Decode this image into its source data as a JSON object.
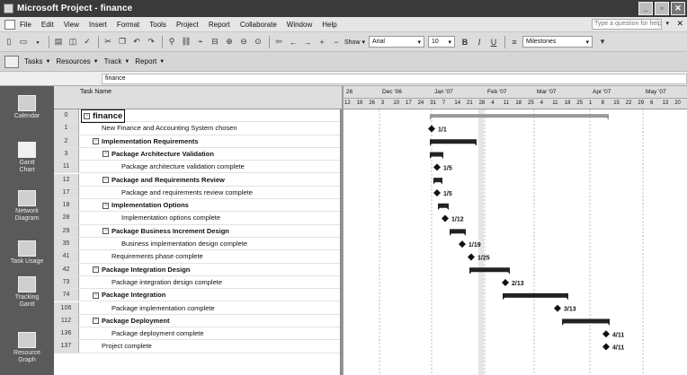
{
  "window": {
    "title": "Microsoft Project - finance",
    "controls": [
      "minimize",
      "restore",
      "close"
    ]
  },
  "menu": {
    "items": [
      "File",
      "Edit",
      "View",
      "Insert",
      "Format",
      "Tools",
      "Project",
      "Report",
      "Collaborate",
      "Window",
      "Help"
    ],
    "help_placeholder": "Type a question for help"
  },
  "toolbar": {
    "show_label": "Show ▾",
    "font": "Arial",
    "font_size": "10",
    "filter": "Milestones",
    "bold": "B",
    "italic": "I",
    "underline": "U"
  },
  "viewbar": {
    "items": [
      "Tasks",
      "Resources",
      "Track",
      "Report"
    ]
  },
  "entry_bar": {
    "value": "finance"
  },
  "view_bar_left": [
    {
      "label": "Calendar",
      "icon": "calendar-icon"
    },
    {
      "label": "Gantt Chart",
      "icon": "gantt-chart-icon"
    },
    {
      "label": "Network Diagram",
      "icon": "network-diagram-icon"
    },
    {
      "label": "Task Usage",
      "icon": "task-usage-icon"
    },
    {
      "label": "Tracking Gantt",
      "icon": "tracking-gantt-icon"
    },
    {
      "label": "Resource Graph",
      "icon": "resource-graph-icon"
    }
  ],
  "table": {
    "header": "Task Name",
    "rows": [
      {
        "id": "0",
        "name": "finance",
        "level": 0,
        "summary": true
      },
      {
        "id": "1",
        "name": "New Finance and Accounting System chosen",
        "level": 1,
        "summary": false
      },
      {
        "id": "2",
        "name": "Implementation Requirements",
        "level": 1,
        "summary": true
      },
      {
        "id": "3",
        "name": "Package Architecture Validation",
        "level": 2,
        "summary": true
      },
      {
        "id": "11",
        "name": "Package architecture validation complete",
        "level": 3,
        "summary": false
      },
      {
        "id": "12",
        "name": "Package and Requirements Review",
        "level": 2,
        "summary": true
      },
      {
        "id": "17",
        "name": "Package and requirements review complete",
        "level": 3,
        "summary": false
      },
      {
        "id": "18",
        "name": "Implementation Options",
        "level": 2,
        "summary": true
      },
      {
        "id": "28",
        "name": "Implementation options complete",
        "level": 3,
        "summary": false
      },
      {
        "id": "29",
        "name": "Package Business Increment Design",
        "level": 2,
        "summary": true
      },
      {
        "id": "35",
        "name": "Business implementation design complete",
        "level": 3,
        "summary": false
      },
      {
        "id": "41",
        "name": "Requirements phase complete",
        "level": 2,
        "summary": false
      },
      {
        "id": "42",
        "name": "Package Integration Design",
        "level": 1,
        "summary": true
      },
      {
        "id": "73",
        "name": "Package integration design complete",
        "level": 2,
        "summary": false
      },
      {
        "id": "74",
        "name": "Package Integration",
        "level": 1,
        "summary": true
      },
      {
        "id": "106",
        "name": "Package implementation complete",
        "level": 2,
        "summary": false
      },
      {
        "id": "112",
        "name": "Package Deployment",
        "level": 1,
        "summary": true
      },
      {
        "id": "136",
        "name": "Package deployment complete",
        "level": 2,
        "summary": false
      },
      {
        "id": "137",
        "name": "Project complete",
        "level": 1,
        "summary": false
      }
    ]
  },
  "timescale": {
    "months": [
      "26",
      "Dec '06",
      "Jan '07",
      "Feb '07",
      "Mar '07",
      "Apr '07",
      "May '07"
    ],
    "days": [
      "12",
      "19",
      "26",
      "3",
      "10",
      "17",
      "24",
      "31",
      "7",
      "14",
      "21",
      "28",
      "4",
      "11",
      "18",
      "25",
      "4",
      "11",
      "18",
      "25",
      "1",
      "8",
      "15",
      "22",
      "29",
      "6",
      "13",
      "20"
    ]
  },
  "gantt": {
    "milestone_labels": {
      "1": "1/1",
      "11": "1/5",
      "17": "1/5",
      "28": "1/12",
      "35": "1/19",
      "41": "1/25",
      "73": "2/13",
      "106": "3/13",
      "136": "4/11",
      "137": "4/11"
    }
  }
}
